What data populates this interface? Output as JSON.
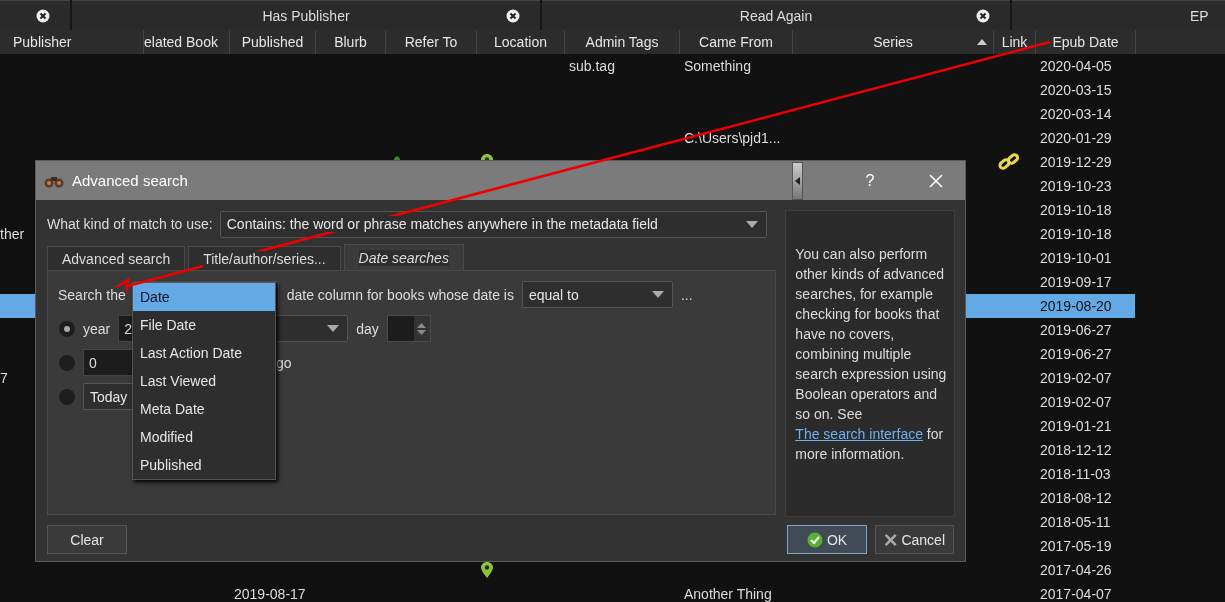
{
  "filter_tabs": [
    {
      "closable": true
    },
    {
      "label": "Has Publisher",
      "closable": true
    },
    {
      "label": "Read Again",
      "closable": true
    },
    {
      "label": "EP",
      "closable": false
    }
  ],
  "columns": [
    {
      "label": "Publisher",
      "sorted": false
    },
    {
      "label": "elated Book",
      "sorted": false
    },
    {
      "label": "Published",
      "sorted": false
    },
    {
      "label": "Blurb",
      "sorted": false
    },
    {
      "label": "Refer To",
      "sorted": false
    },
    {
      "label": "Location",
      "sorted": false
    },
    {
      "label": "Admin Tags",
      "sorted": false
    },
    {
      "label": "Came From",
      "sorted": false
    },
    {
      "label": "Series",
      "sorted": true
    },
    {
      "label": "Link",
      "sorted": false
    },
    {
      "label": "Epub Date",
      "sorted": false
    }
  ],
  "rows": [
    {
      "selected": false,
      "admin_tags": "sub.tag",
      "came_from": "Something",
      "epub_date": "2020-04-05"
    },
    {
      "selected": false,
      "epub_date": "2020-03-15"
    },
    {
      "selected": false,
      "epub_date": "2020-03-14"
    },
    {
      "selected": false,
      "came_from": "C:\\Users\\pjd1...",
      "epub_date": "2020-01-29"
    },
    {
      "selected": false,
      "refer_to_icon": true,
      "location_icon": true,
      "link_icon": true,
      "epub_date": "2019-12-29"
    },
    {
      "selected": false,
      "epub_date": "2019-10-23"
    },
    {
      "selected": false,
      "epub_date": "2019-10-18"
    },
    {
      "selected": false,
      "publisher": "ther",
      "epub_date": "2019-10-18"
    },
    {
      "selected": false,
      "epub_date": "2019-10-01"
    },
    {
      "selected": false,
      "epub_date": "2019-09-17"
    },
    {
      "selected": true,
      "epub_date": "2019-08-20"
    },
    {
      "selected": false,
      "epub_date": "2019-06-27"
    },
    {
      "selected": false,
      "epub_date": "2019-06-27"
    },
    {
      "selected": false,
      "publisher": "7",
      "epub_date": "2019-02-07"
    },
    {
      "selected": false,
      "epub_date": "2019-02-07"
    },
    {
      "selected": false,
      "epub_date": "2019-01-21"
    },
    {
      "selected": false,
      "epub_date": "2018-12-12"
    },
    {
      "selected": false,
      "epub_date": "2018-11-03"
    },
    {
      "selected": false,
      "epub_date": "2018-08-12"
    },
    {
      "selected": false,
      "epub_date": "2018-05-11"
    },
    {
      "selected": false,
      "epub_date": "2017-05-19"
    },
    {
      "selected": false,
      "location_icon": true,
      "epub_date": "2017-04-26"
    },
    {
      "selected": false,
      "published": "2019-08-17",
      "came_from": "Another Thing",
      "epub_date": "2017-04-07"
    }
  ],
  "dialog": {
    "title": "Advanced search",
    "help_button": "?",
    "match_label": "What kind of match to use:",
    "match_value": "Contains: the word or phrase matches anywhere in the metadata field",
    "tabs": [
      {
        "label": "Advanced search",
        "selected": false
      },
      {
        "label": "Title/author/series...",
        "selected": false
      },
      {
        "label": "Date searches",
        "selected": true
      }
    ],
    "search_the": "Search the",
    "column_menu": [
      {
        "label": "Date",
        "selected": true
      },
      {
        "label": "File Date",
        "selected": false
      },
      {
        "label": "Last Action Date",
        "selected": false
      },
      {
        "label": "Last Viewed",
        "selected": false
      },
      {
        "label": "Meta Date",
        "selected": false
      },
      {
        "label": "Modified",
        "selected": false
      },
      {
        "label": "Published",
        "selected": false
      }
    ],
    "column_suffix": "date column for books whose date is",
    "relation": "equal to",
    "more": "...",
    "options": [
      {
        "kind": "year",
        "selected": true,
        "label": "year",
        "value": "2",
        "day_label": "day"
      },
      {
        "kind": "relative",
        "selected": false,
        "value": "0",
        "suffix": "go"
      },
      {
        "kind": "today",
        "selected": false,
        "value": "Today"
      }
    ],
    "help_text": "You can also perform other kinds of advanced searches, for example checking for books that have no covers, combining multiple search expression using Boolean operators and so on. See ",
    "help_link": "The search interface",
    "help_end": " for more information.",
    "clear": "Clear",
    "ok": "OK",
    "cancel": "Cancel"
  }
}
